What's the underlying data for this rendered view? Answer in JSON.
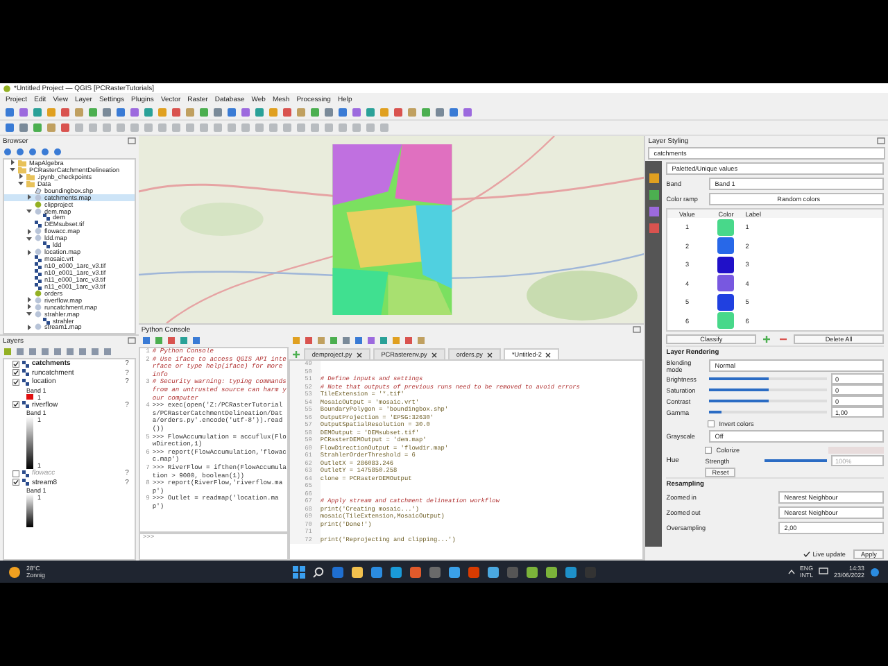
{
  "window": {
    "title": "*Untitled Project — QGIS [PCRasterTutorials]"
  },
  "menu": [
    "Project",
    "Edit",
    "View",
    "Layer",
    "Settings",
    "Plugins",
    "Vector",
    "Raster",
    "Database",
    "Web",
    "Mesh",
    "Processing",
    "Help"
  ],
  "browser": {
    "title": "Browser",
    "items": [
      {
        "label": "MapAlgebra",
        "kind": "folder",
        "selected": false,
        "expanded": false
      },
      {
        "label": "PCRasterCatchmentDelineation",
        "kind": "folder",
        "selected": false,
        "expanded": true,
        "children": [
          {
            "label": ".ipynb_checkpoints",
            "kind": "folder",
            "selected": false,
            "expanded": false
          },
          {
            "label": "Data",
            "kind": "folder",
            "selected": false,
            "expanded": true,
            "children": [
              {
                "label": "boundingbox.shp",
                "kind": "vector",
                "selected": false
              },
              {
                "label": "catchments.map",
                "kind": "map",
                "selected": true,
                "expanded": false
              },
              {
                "label": "clipproject",
                "kind": "project",
                "selected": false
              },
              {
                "label": "dem.map",
                "kind": "map",
                "selected": false,
                "expanded": true,
                "children": [
                  {
                    "label": "dem",
                    "kind": "raster",
                    "selected": false
                  }
                ]
              },
              {
                "label": "DEMsubset.tif",
                "kind": "raster",
                "selected": false
              },
              {
                "label": "flowacc.map",
                "kind": "map",
                "selected": false,
                "expanded": false
              },
              {
                "label": "ldd.map",
                "kind": "map",
                "selected": false,
                "expanded": true,
                "children": [
                  {
                    "label": "ldd",
                    "kind": "raster",
                    "selected": false
                  }
                ]
              },
              {
                "label": "location.map",
                "kind": "map",
                "selected": false,
                "expanded": false
              },
              {
                "label": "mosaic.vrt",
                "kind": "raster",
                "selected": false
              },
              {
                "label": "n10_e000_1arc_v3.tif",
                "kind": "raster",
                "selected": false
              },
              {
                "label": "n10_e001_1arc_v3.tif",
                "kind": "raster",
                "selected": false
              },
              {
                "label": "n11_e000_1arc_v3.tif",
                "kind": "raster",
                "selected": false
              },
              {
                "label": "n11_e001_1arc_v3.tif",
                "kind": "raster",
                "selected": false
              },
              {
                "label": "orders",
                "kind": "project",
                "selected": false
              },
              {
                "label": "riverflow.map",
                "kind": "map",
                "selected": false,
                "expanded": false
              },
              {
                "label": "runcatchment.map",
                "kind": "map",
                "selected": false,
                "expanded": false
              },
              {
                "label": "strahler.map",
                "kind": "map",
                "selected": false,
                "expanded": true,
                "children": [
                  {
                    "label": "strahler",
                    "kind": "raster",
                    "selected": false
                  }
                ]
              },
              {
                "label": "stream1.map",
                "kind": "map",
                "selected": false,
                "expanded": false
              }
            ]
          }
        ]
      }
    ]
  },
  "layers": {
    "title": "Layers",
    "items": [
      {
        "name": "catchments",
        "checked": true,
        "selected": true,
        "badge": "?"
      },
      {
        "name": "runcatchment",
        "checked": true,
        "selected": false,
        "badge": "?"
      },
      {
        "name": "location",
        "checked": true,
        "selected": false,
        "badge": "?",
        "legend": {
          "kind": "swatch",
          "band": "Band 1",
          "color": "#e01010",
          "labels": [
            "1"
          ]
        }
      },
      {
        "name": "riverflow",
        "checked": true,
        "selected": false,
        "badge": "?",
        "legend": {
          "kind": "ramp",
          "band": "Band 1",
          "labels": [
            "1",
            "1"
          ]
        }
      },
      {
        "name": "flowacc",
        "checked": false,
        "selected": false,
        "badge": "?"
      },
      {
        "name": "stream8",
        "checked": true,
        "selected": false,
        "badge": "?",
        "legend": {
          "kind": "ramp",
          "band": "Band 1",
          "labels": [
            "1"
          ]
        }
      }
    ]
  },
  "python_console": {
    "title": "Python Console",
    "prompt": ">>>",
    "lines": [
      {
        "number": "1",
        "kind": "comment",
        "text": "# Python Console"
      },
      {
        "number": "2",
        "kind": "comment",
        "text": "# Use iface to access QGIS API interface or type help(iface) for more info"
      },
      {
        "number": "3",
        "kind": "comment",
        "text": "# Security warning: typing commands from an untrusted source can harm your computer"
      },
      {
        "number": "4",
        "kind": "code",
        "text": ">>> exec(open('Z:/PCRasterTutorials/PCRasterCatchmentDelineation/Data/orders.py'.encode('utf-8')).read())"
      },
      {
        "number": "5",
        "kind": "code",
        "text": ">>> FlowAccumulation = accuflux(FlowDirection,1)"
      },
      {
        "number": "6",
        "kind": "code",
        "text": ">>> report(FlowAccumulation,'flowacc.map')"
      },
      {
        "number": "7",
        "kind": "code",
        "text": ">>> RiverFlow = ifthen(FlowAccumulation > 9000, boolean(1))"
      },
      {
        "number": "8",
        "kind": "code",
        "text": ">>> report(RiverFlow,'riverflow.map')"
      },
      {
        "number": "9",
        "kind": "code",
        "text": ">>> Outlet = readmap('location.map')"
      }
    ]
  },
  "editor": {
    "tabs": [
      {
        "label": "demproject.py",
        "selected": false
      },
      {
        "label": "PCRasterenv.py",
        "selected": false
      },
      {
        "label": "orders.py",
        "selected": false
      },
      {
        "label": "*Untitled-2",
        "selected": true
      }
    ],
    "lines": [
      {
        "number": "49",
        "kind": "blank"
      },
      {
        "number": "50",
        "kind": "blank"
      },
      {
        "number": "51",
        "kind": "comment",
        "text": "# Define inputs and settings"
      },
      {
        "number": "52",
        "kind": "comment",
        "text": "# Note that outputs of previous runs need to be removed to avoid errors"
      },
      {
        "number": "53",
        "kind": "code",
        "text": "TileExtension = '*.tif'"
      },
      {
        "number": "54",
        "kind": "code",
        "text": "MosaicOutput = 'mosaic.vrt'"
      },
      {
        "number": "55",
        "kind": "code",
        "text": "BoundaryPolygon = 'boundingbox.shp'"
      },
      {
        "number": "56",
        "kind": "code",
        "text": "OutputProjection = 'EPSG:32630'"
      },
      {
        "number": "57",
        "kind": "code",
        "text": "OutputSpatialResolution = 30.0"
      },
      {
        "number": "58",
        "kind": "code",
        "text": "DEMOutput = 'DEMsubset.tif'"
      },
      {
        "number": "59",
        "kind": "code",
        "text": "PCRasterDEMOutput = 'dem.map'"
      },
      {
        "number": "60",
        "kind": "code",
        "text": "FlowDirectionOutput = 'flowdir.map'"
      },
      {
        "number": "61",
        "kind": "code",
        "text": "StrahlerOrderThreshold = 6"
      },
      {
        "number": "62",
        "kind": "code",
        "text": "OutletX = 286083.246"
      },
      {
        "number": "63",
        "kind": "code",
        "text": "OutletY = 1475850.258"
      },
      {
        "number": "64",
        "kind": "code",
        "text": "clone = PCRasterDEMOutput"
      },
      {
        "number": "65",
        "kind": "blank"
      },
      {
        "number": "66",
        "kind": "blank"
      },
      {
        "number": "67",
        "kind": "comment",
        "text": "# Apply stream and catchment delineation workflow"
      },
      {
        "number": "68",
        "kind": "code",
        "text": "print('Creating mosaic...')"
      },
      {
        "number": "69",
        "kind": "code",
        "text": "mosaic(TileExtension,MosaicOutput)"
      },
      {
        "number": "70",
        "kind": "code",
        "text": "print('Done!')"
      },
      {
        "number": "71",
        "kind": "blank"
      },
      {
        "number": "72",
        "kind": "code",
        "text": "print('Reprojecting and clipping...')"
      }
    ]
  },
  "layer_styling": {
    "title": "Layer Styling",
    "layer": "catchments",
    "renderer": "Paletted/Unique values",
    "band_label": "Band",
    "band": "Band 1",
    "ramp_label": "Color ramp",
    "ramp": "Random colors",
    "columns": [
      "Value",
      "Color",
      "Label"
    ],
    "classes": [
      {
        "value": "1",
        "color": "#48d88a",
        "label": "1"
      },
      {
        "value": "2",
        "color": "#2868e8",
        "label": "2"
      },
      {
        "value": "3",
        "color": "#2010c8",
        "label": "3"
      },
      {
        "value": "4",
        "color": "#7858e0",
        "label": "4"
      },
      {
        "value": "5",
        "color": "#2040e0",
        "label": "5"
      },
      {
        "value": "6",
        "color": "#48d88a",
        "label": "6"
      }
    ],
    "classify": "Classify",
    "delete_all": "Delete All"
  },
  "rendering": {
    "title": "Layer Rendering",
    "blending_label": "Blending mode",
    "blending": "Normal",
    "sliders": [
      {
        "label": "Brightness",
        "level": 0.5,
        "reading": "0"
      },
      {
        "label": "Saturation",
        "level": 0.5,
        "reading": "0"
      },
      {
        "label": "Contrast",
        "level": 0.5,
        "reading": "0"
      },
      {
        "label": "Gamma",
        "level": 0.1,
        "reading": "1,00"
      }
    ],
    "invert": {
      "label": "Invert colors",
      "checked": false
    },
    "grayscale_label": "Grayscale",
    "grayscale": "Off",
    "hue_label": "Hue",
    "colorize": {
      "label": "Colorize",
      "checked": false
    },
    "strength": {
      "label": "Strength",
      "level": 1,
      "reading": "100%"
    },
    "reset": "Reset"
  },
  "resampling": {
    "title": "Resampling",
    "rows": [
      {
        "label": "Zoomed in",
        "value": "Nearest Neighbour"
      },
      {
        "label": "Zoomed out",
        "value": "Nearest Neighbour"
      },
      {
        "label": "Oversampling",
        "value": "2,00"
      }
    ]
  },
  "footer": {
    "live_update": {
      "label": "Live update",
      "checked": true
    },
    "apply": "Apply"
  },
  "taskbar": {
    "temperature": "28°C",
    "condition": "Zonnig",
    "language": [
      "ENG",
      "INTL"
    ],
    "time": "14:33",
    "date": "23/06/2022"
  }
}
